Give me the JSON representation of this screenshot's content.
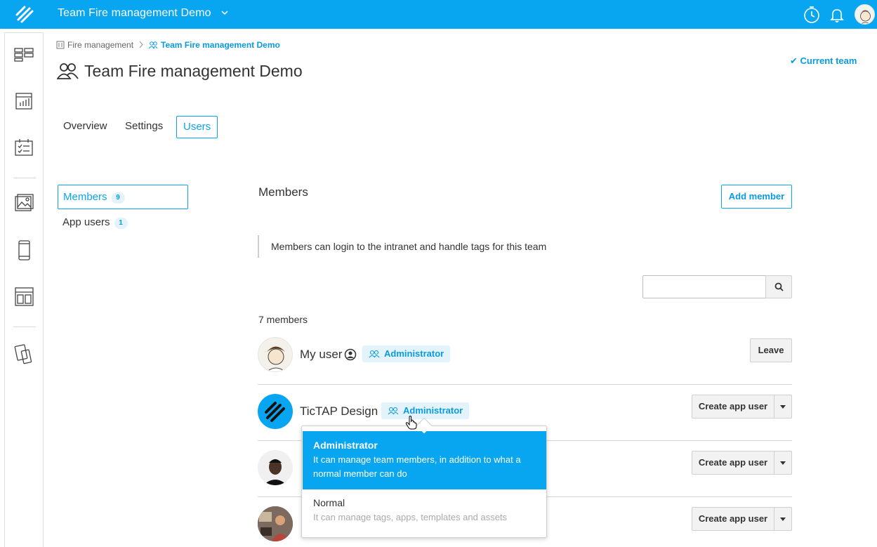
{
  "topbar": {
    "team_title": "Team Fire management Demo",
    "accent": "#08a6f0",
    "icons": [
      "history-icon",
      "bell-icon",
      "user-avatar"
    ]
  },
  "rail": {
    "items": [
      "dashboard-icon",
      "reports-icon",
      "calendar-list-icon",
      "images-icon",
      "mobile-icon",
      "templates-icon",
      "devices-icon"
    ]
  },
  "breadcrumb": {
    "items": [
      {
        "label": "Fire management"
      },
      {
        "label": "Team Fire management Demo"
      }
    ]
  },
  "page": {
    "title": "Team Fire management Demo",
    "current_team": "Current team"
  },
  "tabs": [
    {
      "label": "Overview"
    },
    {
      "label": "Settings"
    },
    {
      "label": "Users"
    }
  ],
  "side_menu": [
    {
      "label": "Members",
      "count": "9"
    },
    {
      "label": "App users",
      "count": "1"
    }
  ],
  "members_section": {
    "title": "Members",
    "add_member": "Add member",
    "note": "Members can login to the intranet and handle tags for this team",
    "search_placeholder": "",
    "count_text": "7 members"
  },
  "members": [
    {
      "name": "My user",
      "role": "Administrator",
      "action": "Leave"
    },
    {
      "name": "TicTAP Design",
      "role": "Administrator",
      "action": "Create app user"
    },
    {
      "name": "",
      "role": "",
      "action": "Create app user"
    },
    {
      "name": "",
      "role": "",
      "action": "Create app user"
    }
  ],
  "role_dropdown": {
    "options": [
      {
        "title": "Administrator",
        "desc": "It can manage team members, in addition to what a normal member can do",
        "selected": true
      },
      {
        "title": "Normal",
        "desc": "It can manage tags, apps, templates and assets",
        "selected": false
      }
    ]
  }
}
